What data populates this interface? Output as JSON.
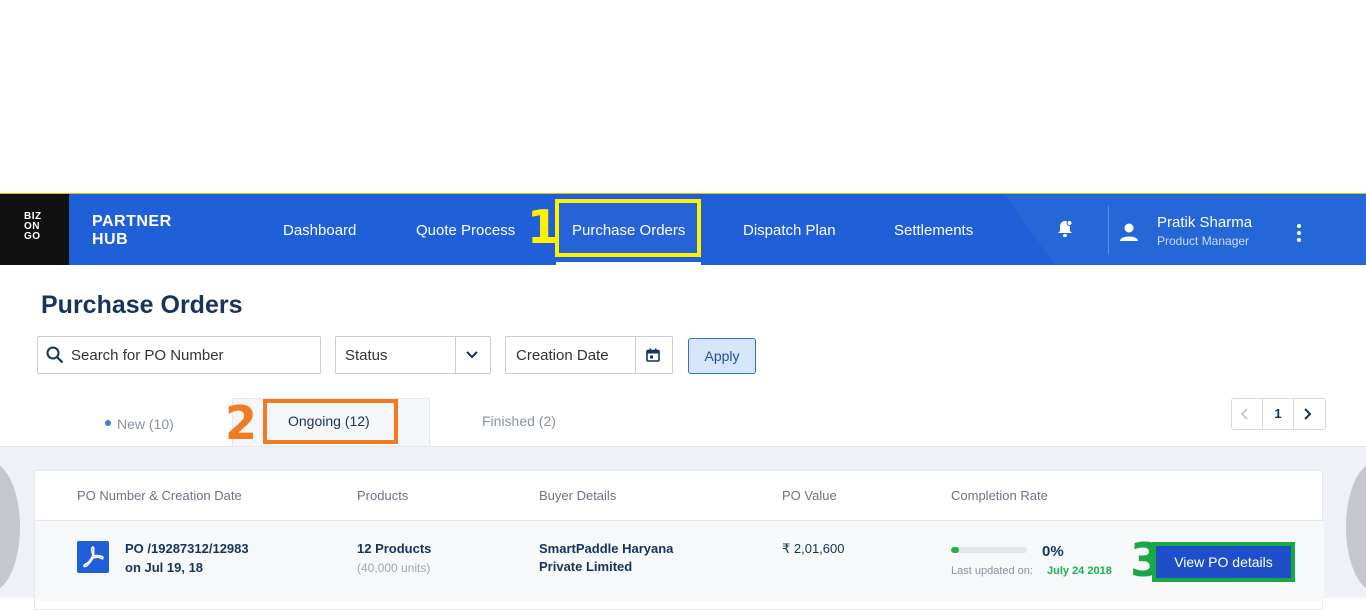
{
  "brand": {
    "logo_line1": "BIZ",
    "logo_line2": "ON",
    "logo_line3": "GO",
    "name_line1": "PARTNER",
    "name_line2": "HUB"
  },
  "nav": {
    "items": [
      "Dashboard",
      "Quote Process",
      "Purchase Orders",
      "Dispatch Plan",
      "Settlements"
    ],
    "active": "Purchase Orders"
  },
  "user": {
    "name": "Pratik Sharma",
    "role": "Product Manager"
  },
  "annotations": {
    "one": "1",
    "two": "2",
    "three": "3"
  },
  "page": {
    "title": "Purchase Orders"
  },
  "filters": {
    "search_placeholder": "Search for PO Number",
    "status_label": "Status",
    "date_label": "Creation Date",
    "apply_label": "Apply"
  },
  "tabs": {
    "new": "New (10)",
    "ongoing": "Ongoing (12)",
    "finished": "Finished (2)"
  },
  "pagination": {
    "current": "1"
  },
  "table": {
    "headers": [
      "PO Number & Creation Date",
      "Products",
      "Buyer Details",
      "PO Value",
      "Completion Rate"
    ],
    "rows": [
      {
        "po_number": "PO /19287312/12983",
        "po_date": "on Jul 19, 18",
        "products": "12 Products",
        "units": "(40,000 units)",
        "buyer_line1": "SmartPaddle Haryana",
        "buyer_line2": "Private Limited",
        "value": "₹ 2,01,600",
        "completion": "0%",
        "completion_fraction": 0.1,
        "updated_label": "Last updated on:",
        "updated_date": "July 24 2018",
        "action": "View PO details"
      }
    ]
  },
  "colors": {
    "nav_bg": "#1f5fd8",
    "highlight_1": "#fff200",
    "highlight_2": "#f27a20",
    "highlight_3": "#1aa847"
  }
}
